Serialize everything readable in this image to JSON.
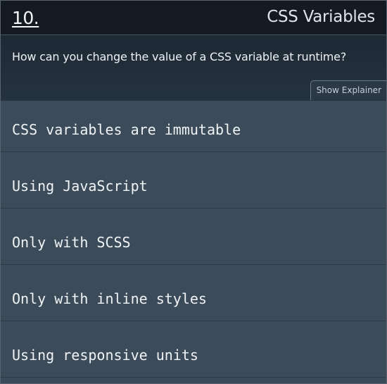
{
  "header": {
    "number": "10.",
    "topic": "CSS Variables"
  },
  "question": {
    "text": "How can you change the value of a CSS variable at runtime?",
    "explainer_label": "Show Explainer"
  },
  "options": [
    {
      "label": "CSS variables are immutable"
    },
    {
      "label": "Using JavaScript"
    },
    {
      "label": "Only with SCSS"
    },
    {
      "label": "Only with inline styles"
    },
    {
      "label": "Using responsive units"
    }
  ],
  "colors": {
    "header_bg": "#131a22",
    "question_bg": "#1d2935",
    "option_bg": "#3b4b59",
    "text": "#f0f3f6"
  }
}
